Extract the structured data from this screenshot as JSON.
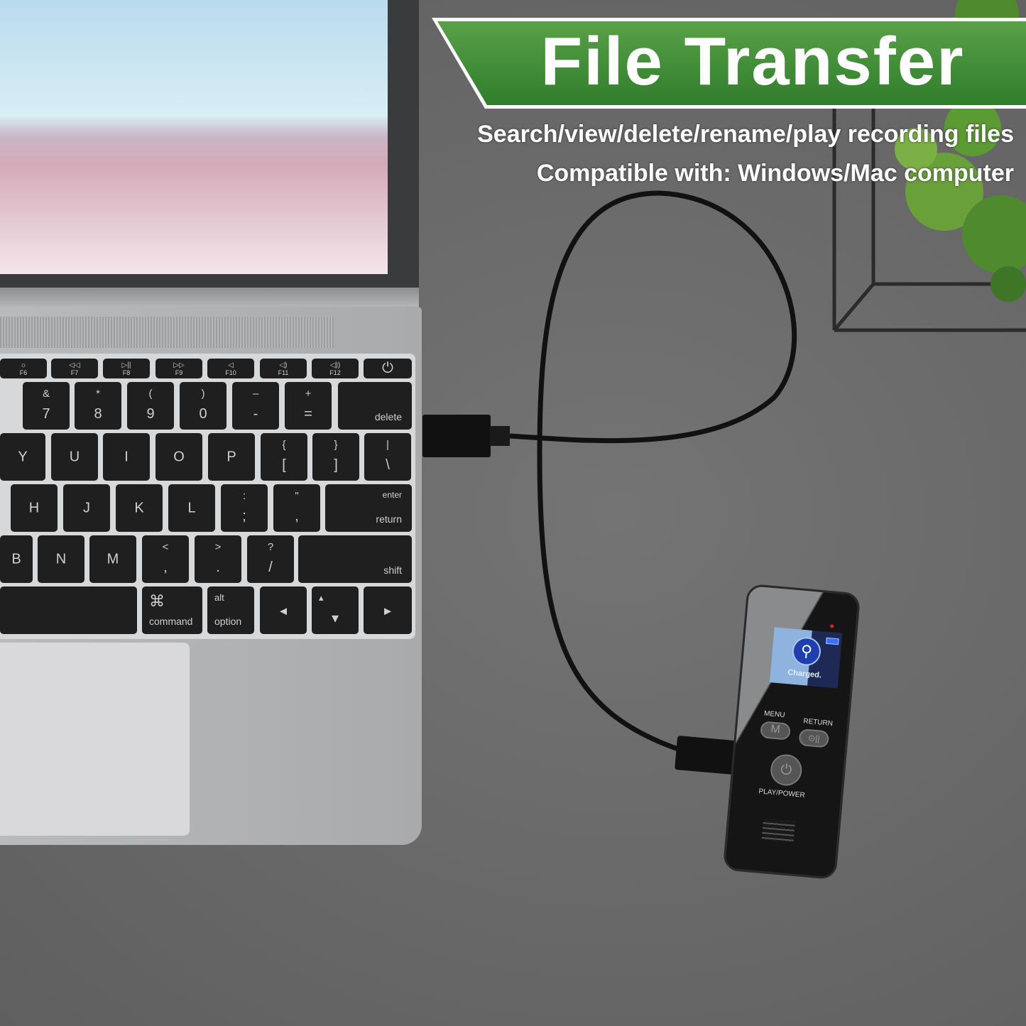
{
  "banner": {
    "title": "File Transfer",
    "color": "#3d8a35"
  },
  "subtitles": [
    "Search/view/delete/rename/play recording files",
    "Compatible with: Windows/Mac computer"
  ],
  "keyboard": {
    "keys": [
      {
        "fi": "☼",
        "fl": "F6"
      },
      {
        "fi": "◁◁",
        "fl": "F7"
      },
      {
        "fi": "▷||",
        "fl": "F8"
      },
      {
        "fi": "▷▷",
        "fl": "F9"
      },
      {
        "fi": "◁",
        "fl": "F10"
      },
      {
        "fi": "◁)",
        "fl": "F11"
      },
      {
        "fi": "◁))",
        "fl": "F12"
      },
      {
        "m": "⏻"
      },
      {
        "t": "&",
        "b": "7"
      },
      {
        "t": "*",
        "b": "8"
      },
      {
        "t": "(",
        "b": "9"
      },
      {
        "t": ")",
        "b": "0"
      },
      {
        "t": "–",
        "b": "-"
      },
      {
        "t": "+",
        "b": "="
      },
      {
        "r": "delete"
      },
      {
        "m": "Y"
      },
      {
        "m": "U"
      },
      {
        "m": "I"
      },
      {
        "m": "O"
      },
      {
        "m": "P"
      },
      {
        "t": "{",
        "b": "["
      },
      {
        "t": "}",
        "b": "]"
      },
      {
        "t": "|",
        "b": "\\"
      },
      {
        "m": "H"
      },
      {
        "m": "J"
      },
      {
        "m": "K"
      },
      {
        "m": "L"
      },
      {
        "t": ":",
        "b": ";"
      },
      {
        "t": "\"",
        "b": ","
      },
      {
        "rt": "enter",
        "r": "return"
      },
      {
        "m": "B"
      },
      {
        "m": "N"
      },
      {
        "m": "M"
      },
      {
        "t": "<",
        "b": ","
      },
      {
        "t": ">",
        "b": "."
      },
      {
        "t": "?",
        "b": "/"
      },
      {
        "r": "shift"
      },
      {},
      {
        "t": "⌘",
        "b": "command"
      },
      {
        "t": "alt",
        "b": "option"
      },
      {
        "m": "◂"
      },
      {
        "t": "▴",
        "b": "▾"
      },
      {
        "m": "▸"
      }
    ]
  },
  "device": {
    "screen_text": "Charged.",
    "menu_label": "MENU",
    "return_label": "RETURN",
    "play_label": "PLAY/POWER",
    "menu_glyph": "M",
    "return_glyph": "⊙||",
    "play_glyph": "⏻"
  }
}
